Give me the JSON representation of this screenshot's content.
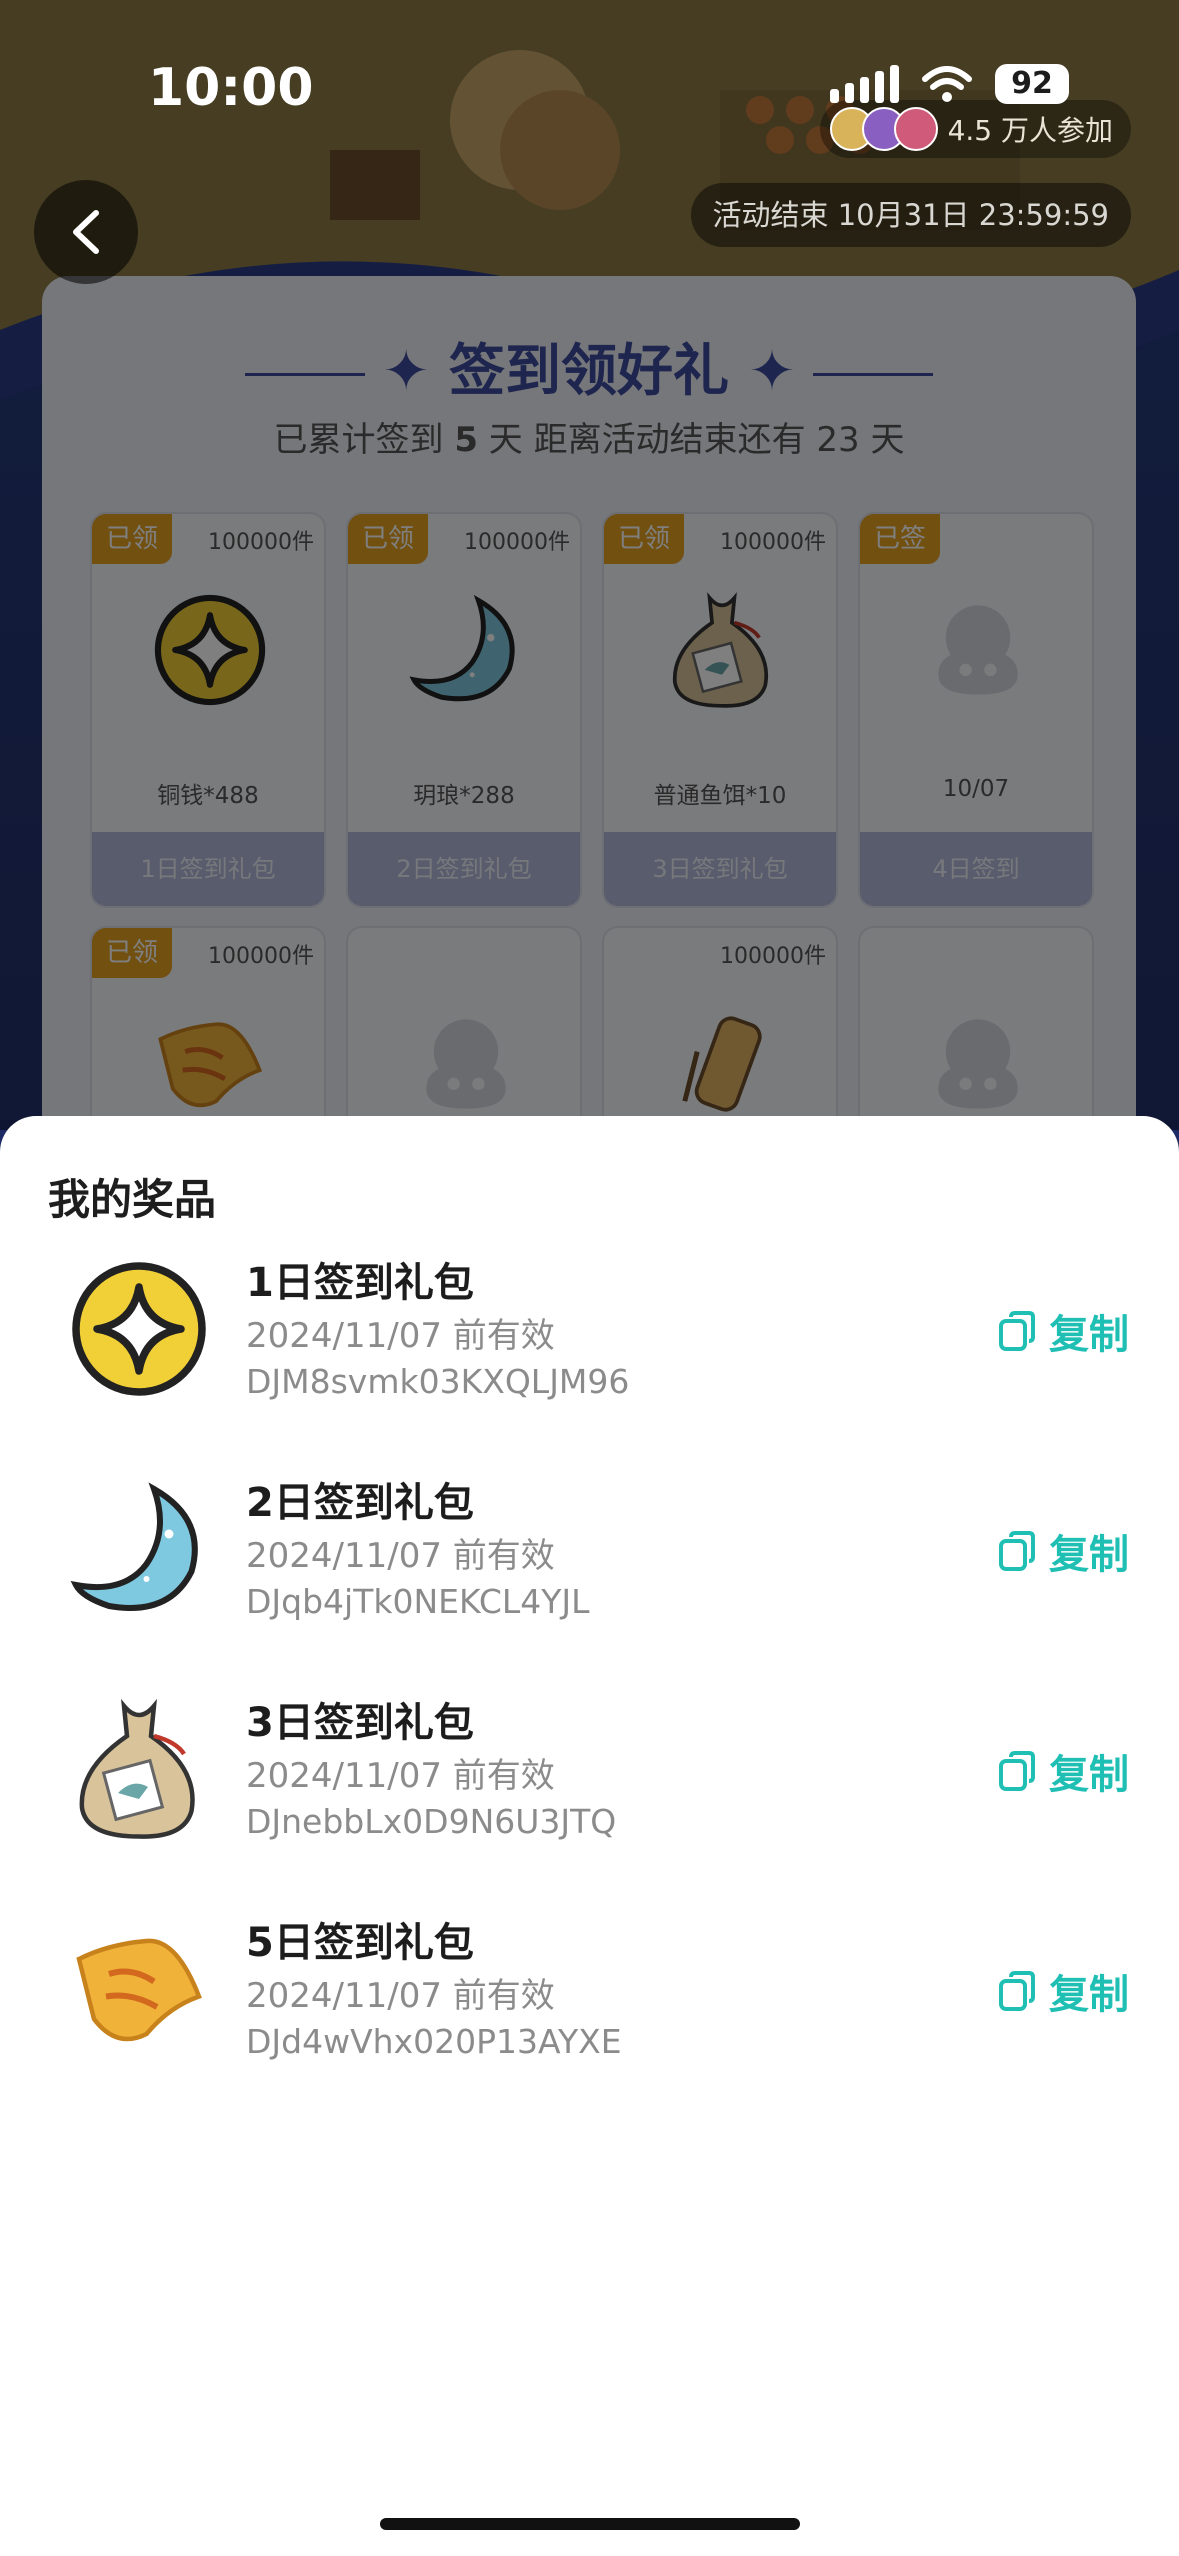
{
  "status": {
    "time": "10:00",
    "battery": "92"
  },
  "header": {
    "participants": "4.5 万人参加",
    "deadline": "活动结束 10月31日 23:59:59"
  },
  "card": {
    "title": "签到领好礼",
    "subtitle_prefix": "已累计签到",
    "days": "5",
    "subtitle_suffix": "天  距离活动结束还有 23 天",
    "cells": [
      {
        "tag": "已领",
        "qty": "100000件",
        "name": "铜钱*488",
        "label": "1日签到礼包",
        "icon": "coin-icon"
      },
      {
        "tag": "已领",
        "qty": "100000件",
        "name": "玥琅*288",
        "label": "2日签到礼包",
        "icon": "moon-gem-icon"
      },
      {
        "tag": "已领",
        "qty": "100000件",
        "name": "普通鱼饵*10",
        "label": "3日签到礼包",
        "icon": "bait-bag-icon"
      },
      {
        "tag": "已签",
        "qty": "",
        "name": "10/07",
        "label": "4日签到",
        "icon": "placeholder-avatar-icon"
      },
      {
        "tag": "已领",
        "qty": "100000件",
        "name": "",
        "label": "",
        "icon": "scroll-ticket-icon"
      },
      {
        "tag": "",
        "qty": "",
        "name": "",
        "label": "",
        "icon": "placeholder-avatar-icon"
      },
      {
        "tag": "",
        "qty": "100000件",
        "name": "",
        "label": "",
        "icon": "scroll-roll-icon"
      },
      {
        "tag": "",
        "qty": "",
        "name": "",
        "label": "",
        "icon": "placeholder-avatar-icon"
      }
    ]
  },
  "sheet": {
    "title": "我的奖品",
    "copy_label": "复制",
    "prizes": [
      {
        "name": "1日签到礼包",
        "valid": "2024/11/07 前有效",
        "code": "DJM8svmk03KXQLJM96",
        "icon": "coin-icon"
      },
      {
        "name": "2日签到礼包",
        "valid": "2024/11/07 前有效",
        "code": "DJqb4jTk0NEKCL4YJL",
        "icon": "moon-gem-icon"
      },
      {
        "name": "3日签到礼包",
        "valid": "2024/11/07 前有效",
        "code": "DJnebbLx0D9N6U3JTQ",
        "icon": "bait-bag-icon"
      },
      {
        "name": "5日签到礼包",
        "valid": "2024/11/07 前有效",
        "code": "DJd4wVhx020P13AYXE",
        "icon": "scroll-ticket-icon"
      }
    ]
  },
  "colors": {
    "accent": "#1fbfb4",
    "tag": "#e3a021",
    "title": "#3c4a9c"
  }
}
